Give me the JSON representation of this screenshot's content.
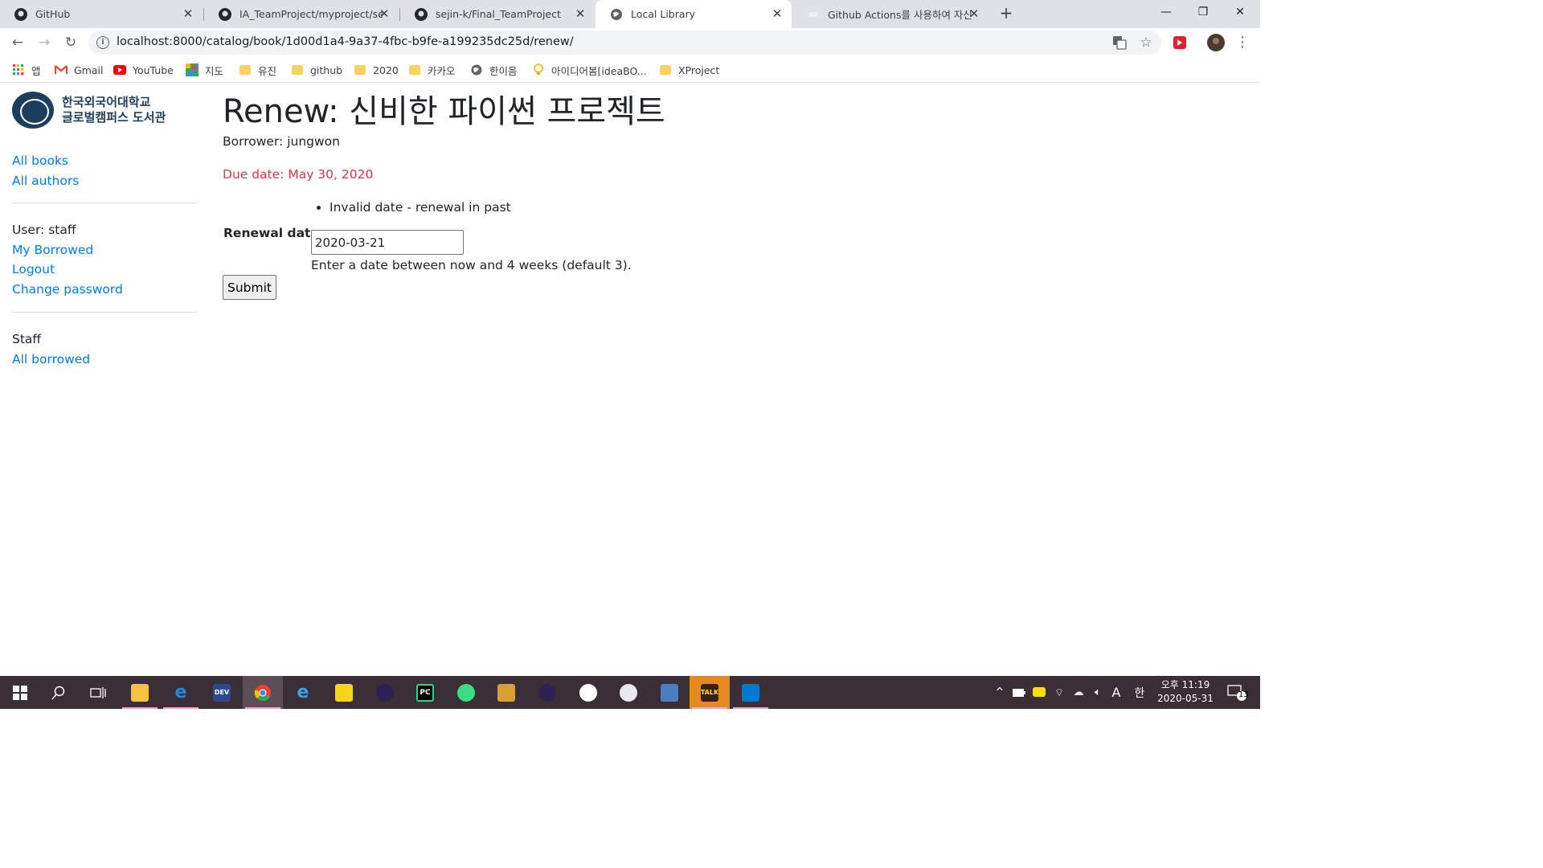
{
  "browser": {
    "tabs": [
      {
        "title": "GitHub",
        "icon": "github-icon"
      },
      {
        "title": "IA_TeamProject/myproject/searc",
        "icon": "github-icon"
      },
      {
        "title": "sejin-k/Final_TeamProject",
        "icon": "github-icon"
      },
      {
        "title": "Local Library",
        "icon": "globe-icon"
      },
      {
        "title": "Github Actions를 사용하여 자신",
        "icon": "blank-icon"
      }
    ],
    "url": "localhost:8000/catalog/book/1d00d1a4-9a37-4fbc-b9fe-a199235dc25d/renew/",
    "bookmarks": [
      {
        "label": "앱",
        "icon": "apps-grid-icon"
      },
      {
        "label": "Gmail",
        "icon": "gmail-icon"
      },
      {
        "label": "YouTube",
        "icon": "youtube-icon"
      },
      {
        "label": "지도",
        "icon": "maps-icon"
      },
      {
        "label": "유진",
        "icon": "folder-icon"
      },
      {
        "label": "github",
        "icon": "folder-icon"
      },
      {
        "label": "2020",
        "icon": "folder-icon"
      },
      {
        "label": "카카오",
        "icon": "folder-icon"
      },
      {
        "label": "한이음",
        "icon": "globe-icon"
      },
      {
        "label": "아이디어봄[ideaBO...",
        "icon": "lightbulb-icon"
      },
      {
        "label": "XProject",
        "icon": "folder-icon"
      }
    ]
  },
  "sidebar": {
    "logo_line1": "한국외국어대학교",
    "logo_line2": "글로벌캠퍼스 도서관",
    "links": [
      "All books",
      "All authors"
    ],
    "user_label": "User: staff",
    "user_links": [
      "My Borrowed",
      "Logout",
      "Change password"
    ],
    "staff_label": "Staff",
    "staff_links": [
      "All borrowed"
    ]
  },
  "main": {
    "title": "Renew: 신비한 파이썬 프로젝트",
    "borrower": "Borrower: jungwon",
    "due_date": "Due date: May 30, 2020",
    "error": "Invalid date - renewal in past",
    "renewal_label": "Renewal date:",
    "renewal_value": "2020-03-21",
    "help_text": "Enter a date between now and 4 weeks (default 3).",
    "submit_label": "Submit"
  },
  "taskbar": {
    "apps": [
      "file-explorer",
      "edge",
      "dev-cpp",
      "chrome",
      "internet-explorer",
      "sticky-notes",
      "eclipse",
      "pycharm",
      "android-studio",
      "network-tool",
      "eclipse-2",
      "notepad",
      "paint",
      "remote-desktop",
      "kakaotalk",
      "vscode"
    ],
    "time_line1": "오후 11:19",
    "time_line2": "2020-05-31",
    "ime_label": "한",
    "lang_label": "A",
    "notification_count": "13"
  },
  "colors": {
    "link": "#007bff",
    "due": "#dc3545",
    "taskbar": "#3a2f35"
  }
}
